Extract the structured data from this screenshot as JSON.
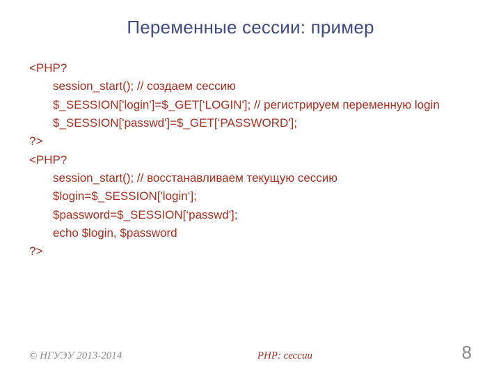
{
  "title": "Переменные сессии: пример",
  "code": {
    "l1": "<PHP?",
    "l2": "session_start(); // создаем сессию",
    "l3": "$_SESSION['login']=$_GET[‘LOGIN']; // регистрируем переменную login",
    "l4": "$_SESSION['passwd']=$_GET[‘PASSWORD'];",
    "l5": "?>",
    "l6": "<PHP?",
    "l7": "session_start(); // восстанавливаем текущую сессию",
    "l8": "$login=$_SESSION['login‘];",
    "l9": "$password=$_SESSION[‘passwd'];",
    "l10": "echo $login, $password",
    "l11": "?>"
  },
  "footer": {
    "left": "© НГУЭУ 2013-2014",
    "center": "PHP: сессии",
    "right": "8"
  }
}
